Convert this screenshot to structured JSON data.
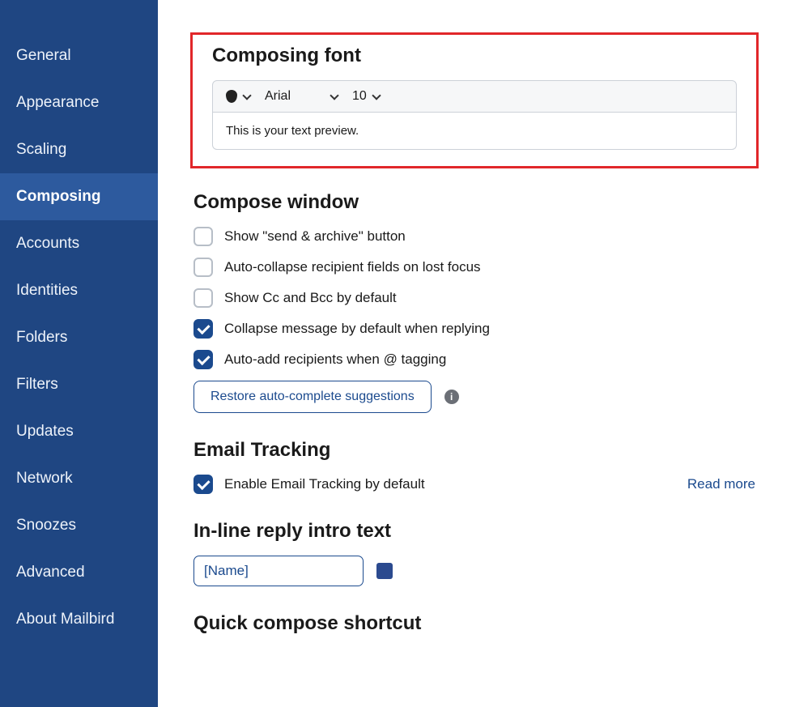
{
  "sidebar": {
    "items": [
      {
        "label": "General"
      },
      {
        "label": "Appearance"
      },
      {
        "label": "Scaling"
      },
      {
        "label": "Composing",
        "active": true
      },
      {
        "label": "Accounts"
      },
      {
        "label": "Identities"
      },
      {
        "label": "Folders"
      },
      {
        "label": "Filters"
      },
      {
        "label": "Updates"
      },
      {
        "label": "Network"
      },
      {
        "label": "Snoozes"
      },
      {
        "label": "Advanced"
      },
      {
        "label": "About Mailbird"
      }
    ]
  },
  "composing_font": {
    "heading": "Composing font",
    "font_family": "Arial",
    "font_size": "10",
    "preview_text": "This is your text preview."
  },
  "compose_window": {
    "heading": "Compose window",
    "opt_send_archive": "Show \"send & archive\" button",
    "opt_auto_collapse": "Auto-collapse recipient fields on lost focus",
    "opt_show_cc_bcc": "Show Cc and Bcc by default",
    "opt_collapse_reply": "Collapse message by default when replying",
    "opt_auto_add_at": "Auto-add recipients when @ tagging",
    "restore_btn": "Restore auto-complete suggestions"
  },
  "email_tracking": {
    "heading": "Email Tracking",
    "opt_enable": "Enable Email Tracking by default",
    "read_more": "Read more"
  },
  "inline_reply": {
    "heading": "In-line reply intro text",
    "value": "[Name]",
    "color": "#2b4a8f"
  },
  "quick_compose": {
    "heading": "Quick compose shortcut"
  }
}
